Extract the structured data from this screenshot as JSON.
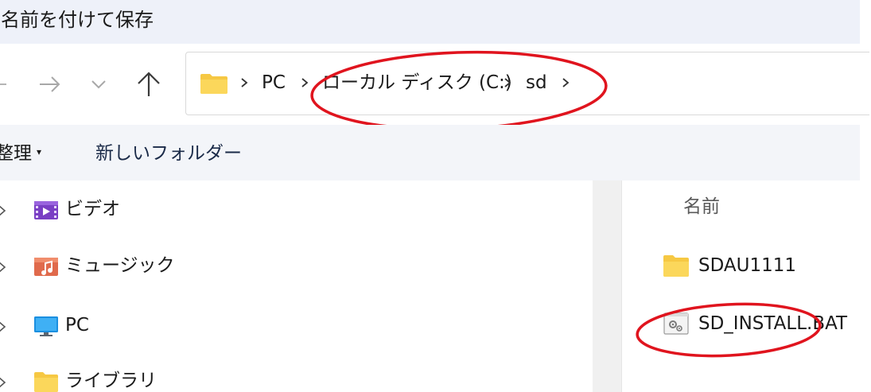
{
  "window": {
    "title": "名前を付けて保存"
  },
  "navigation": {
    "back_icon": "arrow-left-icon",
    "forward_icon": "arrow-right-icon",
    "recent_icon": "chevron-down-icon",
    "up_icon": "arrow-up-icon"
  },
  "address_bar": {
    "breadcrumbs": [
      {
        "label": "PC"
      },
      {
        "label": "ローカル ディスク (C:)"
      },
      {
        "label": "sd"
      }
    ]
  },
  "command_bar": {
    "organize_label": "整理",
    "new_folder_label": "新しいフォルダー"
  },
  "nav_pane": {
    "items": [
      {
        "label": "ビデオ",
        "icon": "videos-folder-icon"
      },
      {
        "label": "ミュージック",
        "icon": "music-folder-icon"
      },
      {
        "label": "PC",
        "icon": "computer-icon"
      },
      {
        "label": "ライブラリ",
        "icon": "folder-icon"
      }
    ]
  },
  "file_list": {
    "column_name": "名前",
    "items": [
      {
        "name": "SDAU1111",
        "icon": "folder-icon"
      },
      {
        "name": "SD_INSTALL.BAT",
        "icon": "batch-file-icon"
      }
    ]
  },
  "colors": {
    "title_bg": "#eef1f9",
    "command_bar_bg": "#f3f5f9",
    "folder_yellow": "#f6c843",
    "annotation_red": "#e0141e"
  }
}
